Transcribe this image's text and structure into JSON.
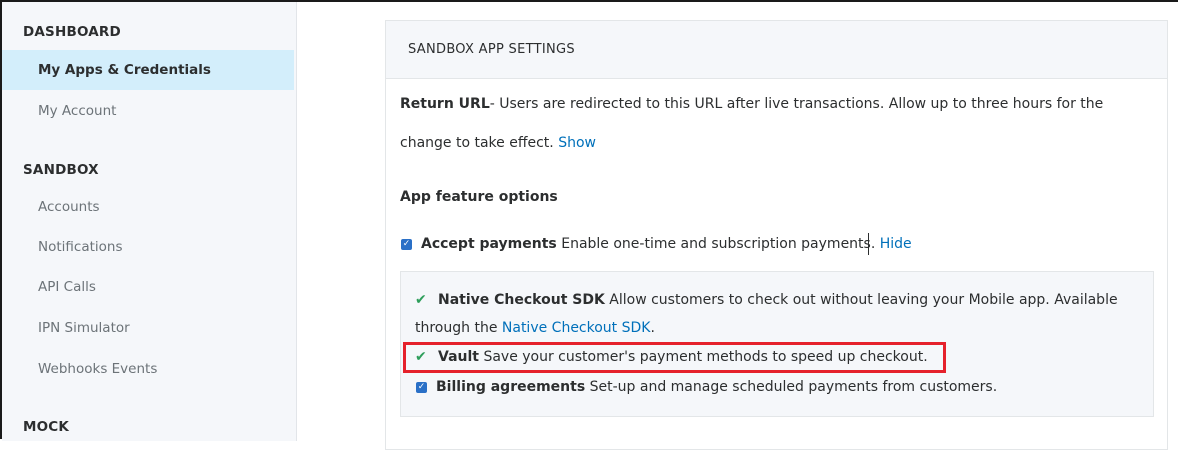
{
  "sidebar": {
    "sections": [
      {
        "heading": "DASHBOARD",
        "items": [
          "My Apps & Credentials",
          "My Account"
        ]
      },
      {
        "heading": "SANDBOX",
        "items": [
          "Accounts",
          "Notifications",
          "API Calls",
          "IPN Simulator",
          "Webhooks Events"
        ]
      },
      {
        "heading": "MOCK",
        "items": []
      }
    ],
    "active_item": "My Apps & Credentials"
  },
  "panel": {
    "title": "SANDBOX APP SETTINGS",
    "return_url": {
      "label": "Return URL",
      "text_line1": "- Users are redirected to this URL after live transactions. Allow up to three hours for the",
      "text_line2": "change to take effect.",
      "link": "Show"
    },
    "features_heading": "App feature options",
    "accept_payments": {
      "checked": true,
      "label": "Accept payments",
      "description": "Enable one-time and subscription payments.",
      "link": "Hide"
    },
    "sub_features": {
      "native_checkout": {
        "label": "Native Checkout SDK",
        "description_line1": "Allow customers to check out without leaving your Mobile app. Available",
        "description_line2_prefix": "through the",
        "link": "Native Checkout SDK",
        "description_line2_suffix": "."
      },
      "vault": {
        "label": "Vault",
        "description": "Save your customer's payment methods to speed up checkout."
      },
      "billing": {
        "checked": true,
        "label": "Billing agreements",
        "description": "Set-up and manage scheduled payments from customers."
      }
    }
  },
  "colors": {
    "accent_blue": "#0070ba",
    "active_nav_bg": "#d3eefb",
    "check_green": "#2e9e5b",
    "highlight_red": "#e5212b"
  }
}
